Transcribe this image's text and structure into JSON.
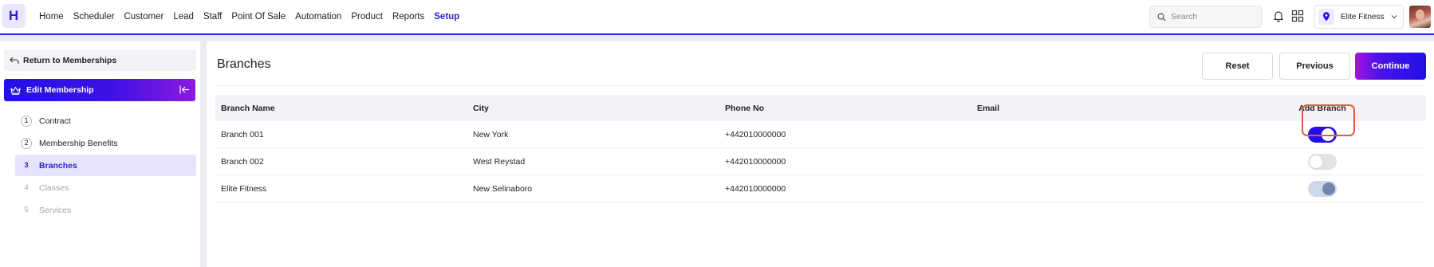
{
  "app": {
    "logo": "H"
  },
  "nav": {
    "items": [
      {
        "label": "Home",
        "active": false
      },
      {
        "label": "Scheduler",
        "active": false
      },
      {
        "label": "Customer",
        "active": false
      },
      {
        "label": "Lead",
        "active": false
      },
      {
        "label": "Staff",
        "active": false
      },
      {
        "label": "Point Of Sale",
        "active": false
      },
      {
        "label": "Automation",
        "active": false
      },
      {
        "label": "Product",
        "active": false
      },
      {
        "label": "Reports",
        "active": false
      },
      {
        "label": "Setup",
        "active": true
      }
    ]
  },
  "header": {
    "search_placeholder": "Search",
    "location": "Elite Fitness",
    "icons": [
      "search-icon",
      "bell-icon",
      "apps-grid-icon",
      "location-pin-icon",
      "chevron-down-icon"
    ]
  },
  "sidebar": {
    "return_label": "Return to Memberships",
    "section_label": "Edit Membership",
    "steps": [
      {
        "num": "1",
        "label": "Contract",
        "state": "default"
      },
      {
        "num": "2",
        "label": "Membership Benefits",
        "state": "default"
      },
      {
        "num": "3",
        "label": "Branches",
        "state": "active"
      },
      {
        "num": "4",
        "label": "Classes",
        "state": "disabled"
      },
      {
        "num": "5",
        "label": "Services",
        "state": "disabled"
      }
    ]
  },
  "main": {
    "title": "Branches",
    "buttons": {
      "reset": "Reset",
      "previous": "Previous",
      "continue": "Continue"
    },
    "table": {
      "columns": [
        "Branch Name",
        "City",
        "Phone No",
        "Email",
        "Add Branch"
      ],
      "rows": [
        {
          "name": "Branch 001",
          "city": "New York",
          "phone": "+442010000000",
          "email": "",
          "add_branch": "on"
        },
        {
          "name": "Branch 002",
          "city": "West Reystad",
          "phone": "+442010000000",
          "email": "",
          "add_branch": "off"
        },
        {
          "name": "Elite Fitness",
          "city": "New Selinaboro",
          "phone": "+442010000000",
          "email": "",
          "add_branch": "on-disabled"
        }
      ]
    }
  },
  "colors": {
    "accent": "#2211e6",
    "highlight": "#e05a44",
    "gradient_end": "#a313e0"
  }
}
